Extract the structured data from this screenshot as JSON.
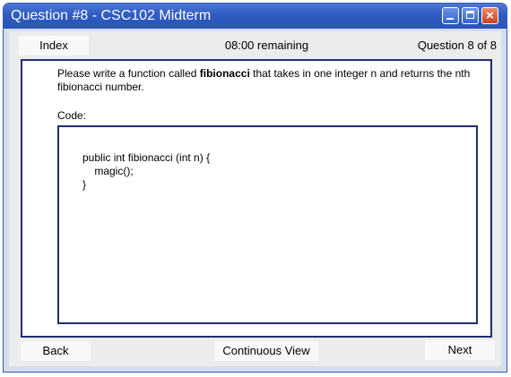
{
  "window": {
    "title": "Question #8 - CSC102 Midterm",
    "controls": [
      "minimize-icon",
      "maximize-icon",
      "close-icon"
    ],
    "close_glyph": "×"
  },
  "topbar": {
    "index_label": "Index",
    "time_remaining": "08:00 remaining",
    "question_counter": "Question 8 of 8"
  },
  "question": {
    "prompt_before": "Please write a function called ",
    "prompt_bold": "fibionacci",
    "prompt_after": " that takes in one integer n and returns the nth fibionacci number.",
    "code_label": "Code:",
    "code_lines": [
      "public int fibionacci (int n) {",
      "    magic();",
      "}"
    ]
  },
  "bottombar": {
    "back_label": "Back",
    "continuous_view_label": "Continuous View",
    "next_label": "Next"
  },
  "colors": {
    "titlebar": "#2f5bc2",
    "frame": "#d6deec",
    "panel_border": "#1e2f6e",
    "close_button": "#c9431e"
  }
}
